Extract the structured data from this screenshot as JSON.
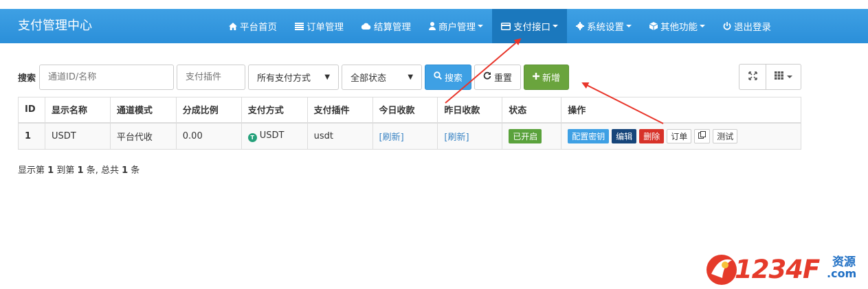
{
  "navbar": {
    "brand": "支付管理中心",
    "items": [
      {
        "label": "平台首页",
        "icon": "home-icon",
        "dropdown": false,
        "active": false
      },
      {
        "label": "订单管理",
        "icon": "list-icon",
        "dropdown": false,
        "active": false
      },
      {
        "label": "结算管理",
        "icon": "cloud-icon",
        "dropdown": false,
        "active": false
      },
      {
        "label": "商户管理",
        "icon": "user-icon",
        "dropdown": true,
        "active": false
      },
      {
        "label": "支付接口",
        "icon": "credit-card-icon",
        "dropdown": true,
        "active": true
      },
      {
        "label": "系统设置",
        "icon": "gear-icon",
        "dropdown": true,
        "active": false
      },
      {
        "label": "其他功能",
        "icon": "cube-icon",
        "dropdown": true,
        "active": false
      },
      {
        "label": "退出登录",
        "icon": "power-icon",
        "dropdown": false,
        "active": false
      }
    ]
  },
  "toolbar": {
    "search_label": "搜索",
    "channel_placeholder": "通道ID/名称",
    "plugin_placeholder": "支付插件",
    "pay_type_selected": "所有支付方式",
    "status_selected": "全部状态",
    "search_button": "搜索",
    "reset_button": "重置",
    "add_button": "新增"
  },
  "table": {
    "headers": [
      "ID",
      "显示名称",
      "通道模式",
      "分成比例",
      "支付方式",
      "支付插件",
      "今日收款",
      "昨日收款",
      "状态",
      "操作"
    ],
    "rows": [
      {
        "id": "1",
        "name": "USDT",
        "mode": "平台代收",
        "ratio": "0.00",
        "pay_type": "USDT",
        "plugin": "usdt",
        "today": "[刷新]",
        "yesterday": "[刷新]",
        "status": "已开启",
        "ops": {
          "key": "配置密钥",
          "edit": "编辑",
          "delete": "删除",
          "orders": "订单",
          "test": "测试"
        }
      }
    ]
  },
  "pager": {
    "prefix": "显示第",
    "from": "1",
    "mid": "到第",
    "to": "1",
    "suffix": "条, 总共",
    "total": "1",
    "end": "条"
  },
  "watermark": {
    "brand_number": "1234F",
    "brand_suffix": ".com",
    "brand_cn": "资源"
  },
  "colors": {
    "navbar": "#2b8fd9",
    "navbar_active": "#1b78bd",
    "primary": "#3ea0e4",
    "success": "#6aa43d",
    "danger": "#d73229",
    "dark": "#16457a",
    "arrow": "#e8352a"
  }
}
